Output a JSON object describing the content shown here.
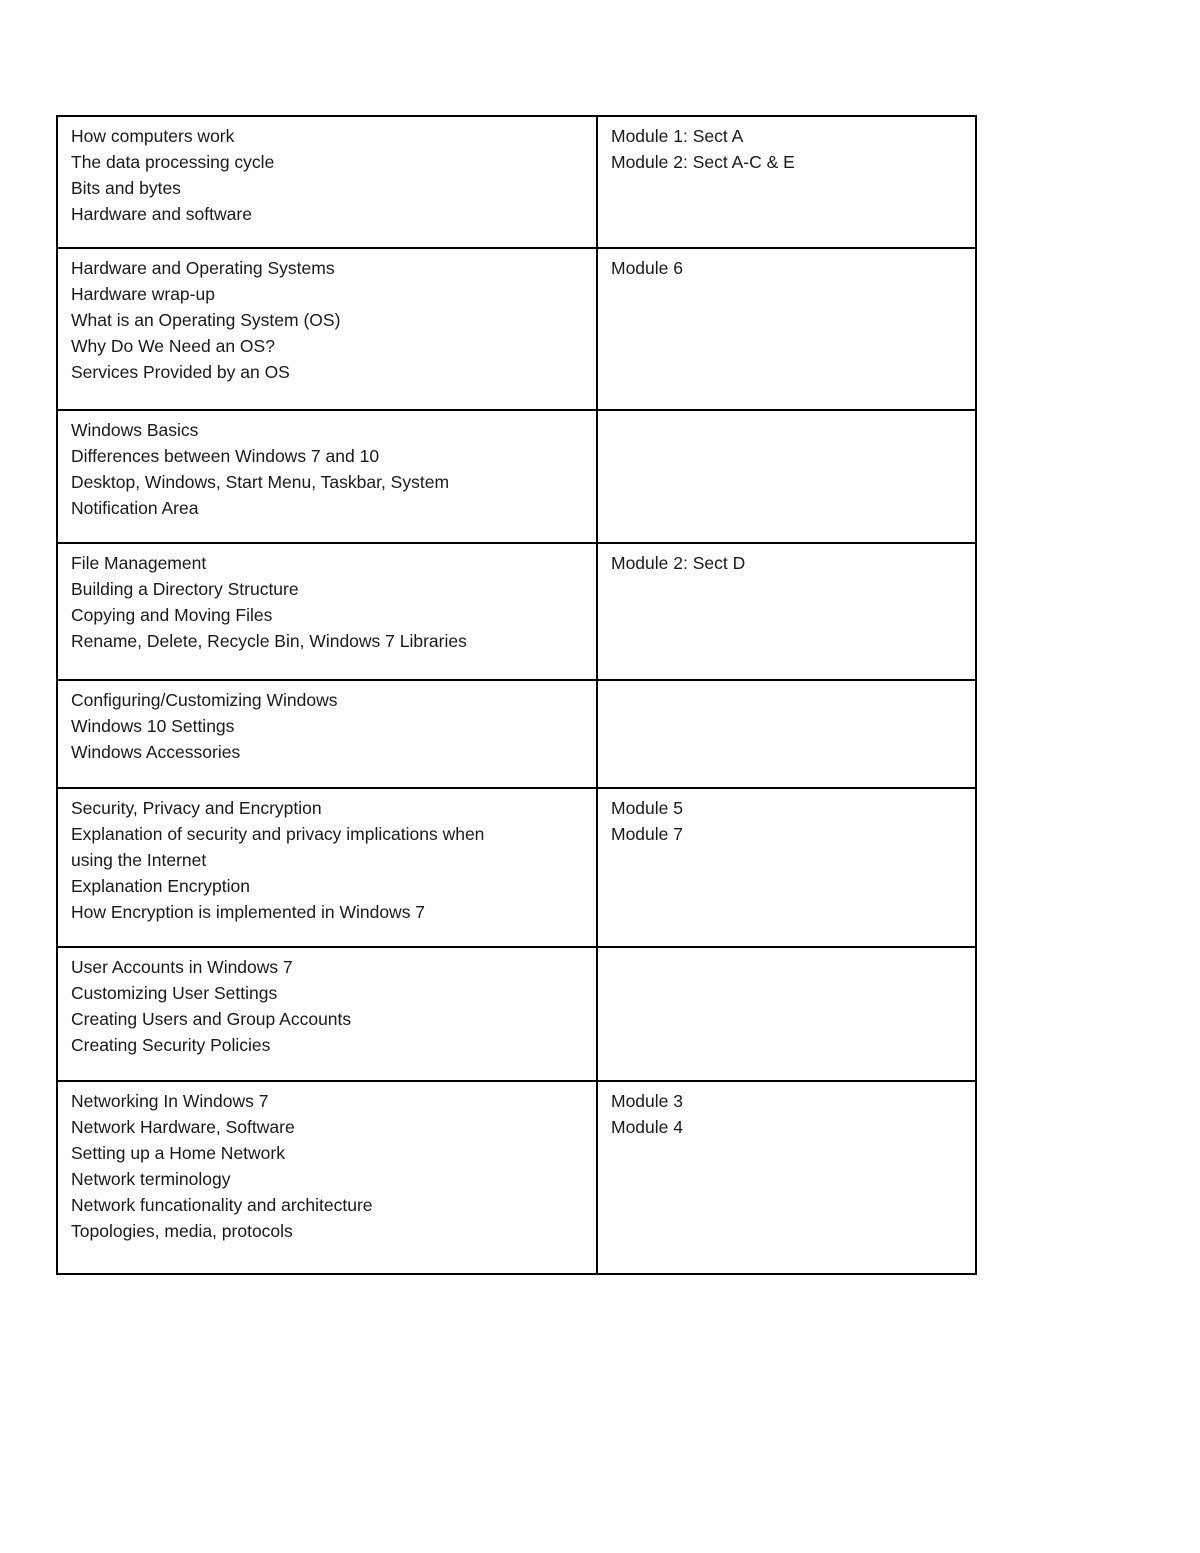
{
  "document": {
    "type": "course-syllabus-table",
    "page_background": "#ffffff",
    "text_color": "#1a1a1a",
    "border_color": "#000000"
  },
  "table": {
    "columns": [
      {
        "key": "topic",
        "header_visible": false
      },
      {
        "key": "module",
        "header_visible": false
      }
    ],
    "rows": [
      {
        "row_height_class": "row-h-130",
        "topic_lines": [
          "How computers work",
          "The data processing cycle",
          "Bits and bytes",
          "Hardware and software"
        ],
        "module_lines": [
          "Module 1: Sect A",
          "Module 2: Sect A-C & E"
        ]
      },
      {
        "row_height_class": "row-h-160",
        "topic_lines": [
          "Hardware and Operating Systems",
          "Hardware wrap-up",
          "What is an Operating System (OS)",
          "Why Do We Need an OS?",
          "Services Provided by an OS"
        ],
        "module_lines": [
          "Module 6"
        ]
      },
      {
        "row_height_class": "row-h-131",
        "topic_lines": [
          "Windows Basics",
          "Differences between Windows 7 and 10",
          "Desktop, Windows, Start Menu, Taskbar, System",
          "Notification Area"
        ],
        "module_lines": []
      },
      {
        "row_height_class": "row-h-135",
        "topic_lines": [
          "File Management",
          "Building a Directory Structure",
          "Copying and Moving Files",
          "Rename, Delete, Recycle Bin, Windows 7 Libraries"
        ],
        "module_lines": [
          "Module 2: Sect D"
        ]
      },
      {
        "row_height_class": "row-h-106",
        "topic_lines": [
          "Configuring/Customizing Windows",
          "Windows 10 Settings",
          "Windows Accessories"
        ],
        "module_lines": []
      },
      {
        "row_height_class": "row-h-157",
        "topic_lines": [
          "Security, Privacy and Encryption",
          "Explanation of security and privacy implications when",
          "using the Internet",
          "Explanation Encryption",
          "How Encryption is implemented in Windows 7"
        ],
        "module_lines": [
          "Module 5",
          "Module 7"
        ]
      },
      {
        "row_height_class": "row-h-132",
        "topic_lines": [
          "User Accounts in Windows 7",
          "Customizing User Settings",
          "Creating Users and Group Accounts",
          "Creating Security Policies"
        ],
        "module_lines": []
      },
      {
        "row_height_class": "row-h-191",
        "topic_lines": [
          "Networking In Windows 7",
          "Network Hardware, Software",
          "Setting up a Home Network",
          "Network terminology",
          "Network funcationality and architecture",
          "Topologies, media, protocols"
        ],
        "module_lines": [
          "Module 3",
          "Module 4"
        ]
      }
    ]
  }
}
